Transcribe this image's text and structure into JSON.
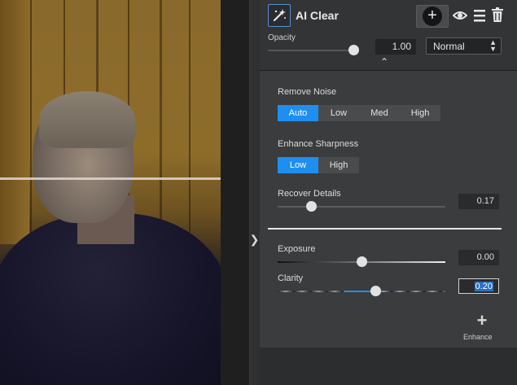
{
  "layer": {
    "title": "AI Clear",
    "opacity_label": "Opacity",
    "opacity_value": "1.00",
    "opacity_fraction": 1.0,
    "blend_mode": "Normal"
  },
  "settings": {
    "remove_noise": {
      "label": "Remove Noise",
      "options": [
        "Auto",
        "Low",
        "Med",
        "High"
      ],
      "selected": "Auto"
    },
    "enhance_sharpness": {
      "label": "Enhance Sharpness",
      "options": [
        "Low",
        "High"
      ],
      "selected": "Low"
    },
    "recover_details": {
      "label": "Recover Details",
      "value": "0.17"
    },
    "exposure": {
      "label": "Exposure",
      "value": "0.00"
    },
    "clarity": {
      "label": "Clarity",
      "value": "0.20"
    },
    "enhance_label": "Enhance"
  },
  "colors": {
    "accent": "#1e8ff0",
    "panel": "#3b3c3d"
  },
  "icons": [
    "magic-wand-icon",
    "add-circle-icon",
    "eye-icon",
    "menu-icon",
    "trash-icon",
    "chevron-up-icon",
    "chevron-right-icon",
    "plus-icon"
  ]
}
